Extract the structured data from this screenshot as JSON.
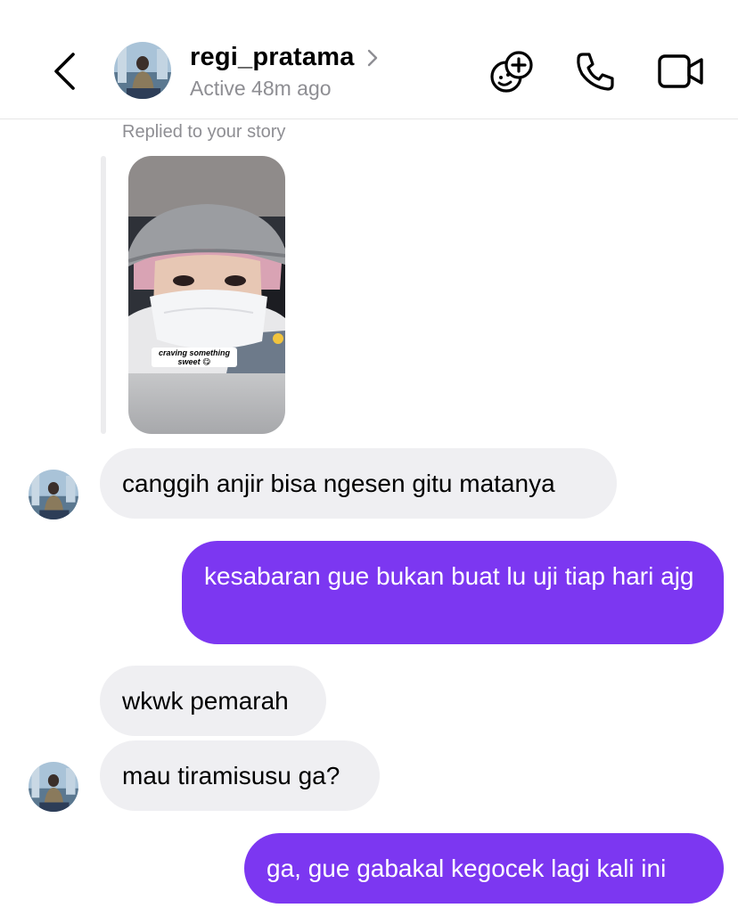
{
  "header": {
    "username": "regi_pratama",
    "status": "Active 48m ago",
    "icons": {
      "back": "chevron-left-icon",
      "profile_chevron": "chevron-right-icon",
      "effects": "sticker-add-icon",
      "call": "phone-icon",
      "video": "video-camera-icon"
    }
  },
  "story_reply": {
    "caption": "Replied to your story",
    "sticker_line1": "craving something",
    "sticker_line2": "sweet 😋"
  },
  "messages": [
    {
      "side": "in",
      "text": "canggih anjir bisa ngesen gitu matanya"
    },
    {
      "side": "out",
      "text": "kesabaran gue bukan buat lu uji tiap hari ajg"
    },
    {
      "side": "in",
      "text": "wkwk pemarah"
    },
    {
      "side": "in",
      "text": "mau tiramisusu ga?"
    },
    {
      "side": "out",
      "text": "ga, gue gabakal kegocek lagi kali ini"
    }
  ],
  "colors": {
    "outgoing_bubble": "#7c37f1",
    "incoming_bubble": "#efeff2",
    "secondary_text": "#8e8e93"
  }
}
